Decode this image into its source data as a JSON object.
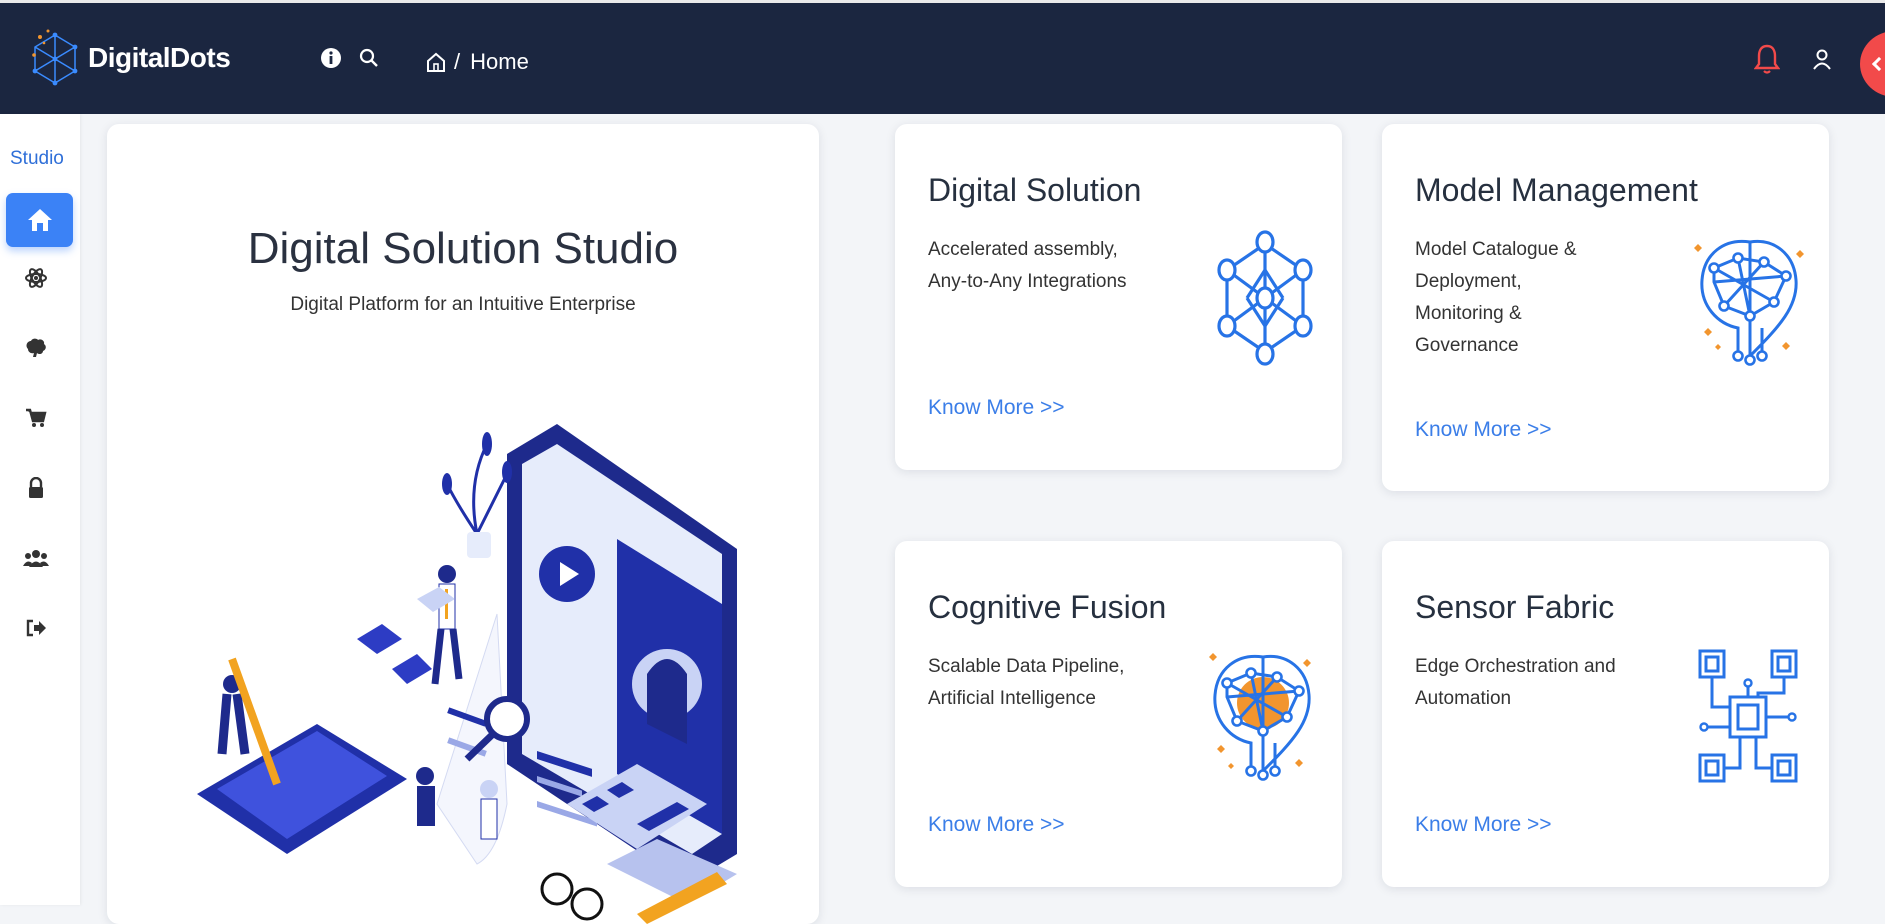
{
  "app": {
    "name": "DigitalDots"
  },
  "breadcrumb": {
    "separator": "/",
    "current": "Home"
  },
  "sidebar": {
    "title": "Studio"
  },
  "hero": {
    "title": "Digital Solution Studio",
    "subtitle": "Digital Platform for an Intuitive Enterprise"
  },
  "cards": [
    {
      "title": "Digital Solution",
      "desc": [
        "Accelerated assembly,",
        "Any-to-Any Integrations"
      ],
      "link": "Know More >>"
    },
    {
      "title": "Model Management",
      "desc": [
        "Model Catalogue &",
        "Deployment,",
        "Monitoring &",
        "Governance"
      ],
      "link": "Know More >>"
    },
    {
      "title": "Cognitive Fusion",
      "desc": [
        "Scalable Data Pipeline,",
        "Artificial Intelligence"
      ],
      "link": "Know More >>"
    },
    {
      "title": "Sensor Fabric",
      "desc": [
        "Edge Orchestration and",
        "Automation"
      ],
      "link": "Know More >>"
    }
  ],
  "colors": {
    "nav_bg": "#1b2640",
    "accent": "#3b82f6",
    "alert": "#f24a4a",
    "link": "#3b7ee8",
    "art_orange": "#f2952e"
  }
}
